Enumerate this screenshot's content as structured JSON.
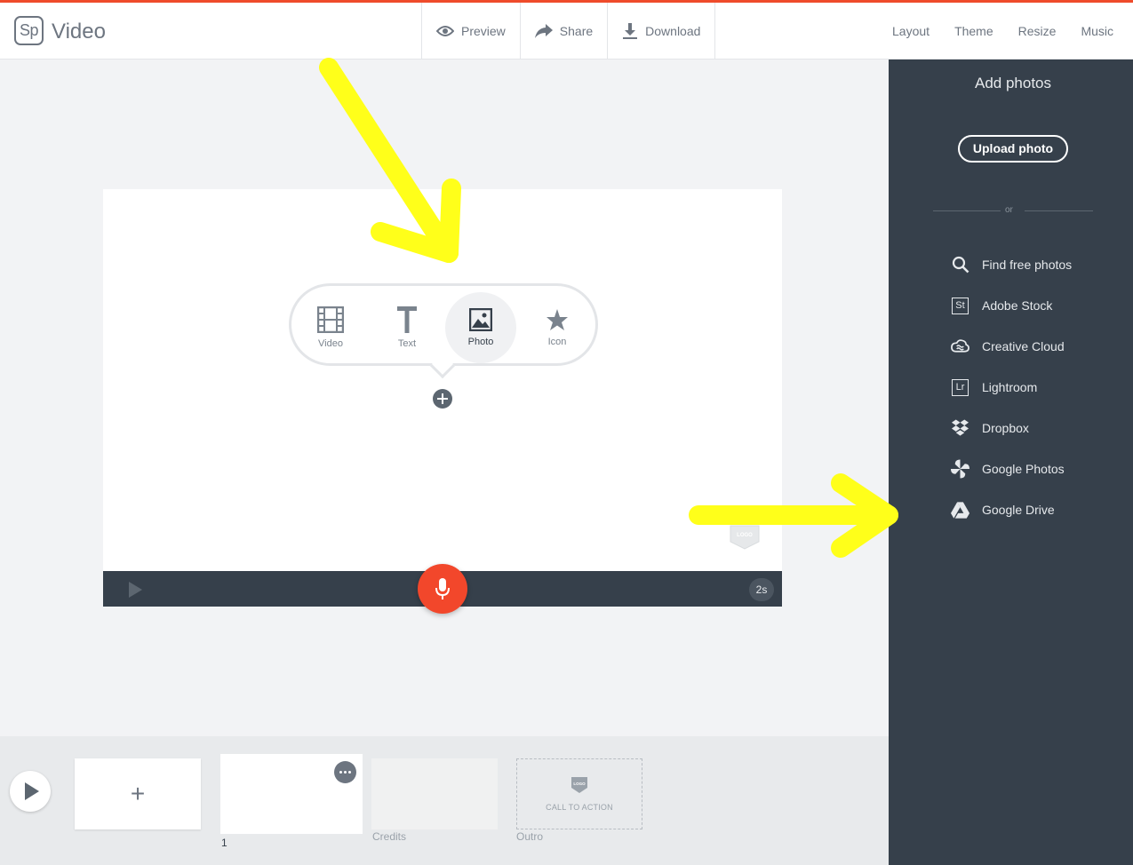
{
  "app": {
    "logo_text": "Sp",
    "title": "Video"
  },
  "toolbar": {
    "preview": "Preview",
    "share": "Share",
    "download": "Download"
  },
  "menu": {
    "layout": "Layout",
    "theme": "Theme",
    "resize": "Resize",
    "music": "Music"
  },
  "popover": {
    "items": [
      {
        "label": "Video",
        "icon": "film-icon"
      },
      {
        "label": "Text",
        "icon": "text-icon"
      },
      {
        "label": "Photo",
        "icon": "image-icon",
        "selected": true
      },
      {
        "label": "Icon",
        "icon": "star-icon"
      }
    ]
  },
  "canvas": {
    "duration": "2s",
    "logo_placeholder": "LOGO"
  },
  "panel": {
    "title": "Add photos",
    "upload_label": "Upload photo",
    "or_label": "or",
    "sources": [
      {
        "label": "Find free photos",
        "icon": "search-icon"
      },
      {
        "label": "Adobe Stock",
        "icon": "St"
      },
      {
        "label": "Creative Cloud",
        "icon": "creative-cloud-icon"
      },
      {
        "label": "Lightroom",
        "icon": "Lr"
      },
      {
        "label": "Dropbox",
        "icon": "dropbox-icon"
      },
      {
        "label": "Google Photos",
        "icon": "google-photos-icon"
      },
      {
        "label": "Google Drive",
        "icon": "google-drive-icon"
      }
    ]
  },
  "timeline": {
    "add_symbol": "+",
    "slide_number": "1",
    "credits_label": "Credits",
    "outro_label": "Outro",
    "cta_text": "CALL TO ACTION",
    "outro_logo": "LOGO"
  },
  "colors": {
    "accent": "#ef4b2b",
    "mic": "#f2472b",
    "panel": "#36404b",
    "annotation": "#ffff1a"
  }
}
